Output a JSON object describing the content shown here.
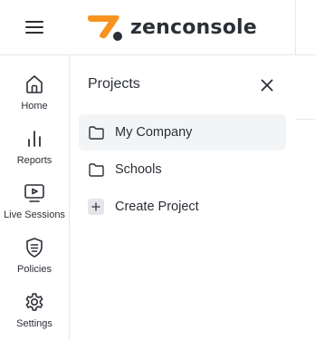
{
  "header": {
    "logo_text": "zenconsole",
    "logo_colors": {
      "mark": "#f7931e",
      "dot": "#2b2f36"
    },
    "menu_icon": "hamburger-icon"
  },
  "sidebar": {
    "items": [
      {
        "label": "Home",
        "icon": "home-icon"
      },
      {
        "label": "Reports",
        "icon": "bar-chart-icon"
      },
      {
        "label": "Live Sessions",
        "icon": "monitor-play-icon"
      },
      {
        "label": "Policies",
        "icon": "shield-icon"
      },
      {
        "label": "Settings",
        "icon": "gear-icon"
      }
    ]
  },
  "panel": {
    "title": "Projects",
    "close_icon": "close-icon",
    "projects": [
      {
        "label": "My Company",
        "icon": "folder-icon",
        "active": true
      },
      {
        "label": "Schools",
        "icon": "folder-icon",
        "active": false
      }
    ],
    "create_label": "Create Project",
    "create_icon": "plus-icon"
  },
  "colors": {
    "accent": "#f7931e",
    "text": "#2b2f36",
    "border": "#e6e8ec",
    "active_bg": "#f3f4f6"
  }
}
